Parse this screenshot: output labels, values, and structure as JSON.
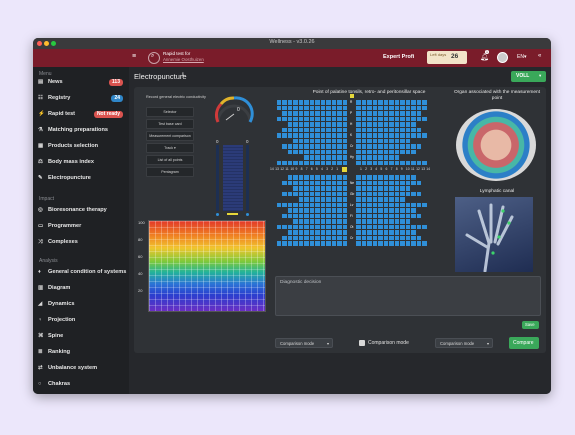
{
  "window": {
    "title": "Wellness - v3.0.26"
  },
  "topbar": {
    "search_title": "Rapid test for",
    "search_sub": "Annemie Oosthuizen",
    "profile": "Expert Profi",
    "days_label": "Left days",
    "days_value": "26",
    "notif_count": "1",
    "lang": "EN▾"
  },
  "sidebar": {
    "section_menu": "Menu",
    "section_impact": "Impact",
    "section_analysis": "Analysis",
    "items": [
      {
        "label": "News",
        "icon": "news-icon",
        "badge": "113"
      },
      {
        "label": "Registry",
        "icon": "registry-icon",
        "badge": "24"
      },
      {
        "label": "Rapid test",
        "icon": "rapid-test-icon",
        "badge": "Not ready"
      },
      {
        "label": "Matching preparations",
        "icon": "matching-icon"
      },
      {
        "label": "Products selection",
        "icon": "products-icon"
      },
      {
        "label": "Body mass index",
        "icon": "bmi-icon"
      },
      {
        "label": "Electropuncture",
        "icon": "pen-icon"
      },
      {
        "label": "Bioresonance therapy",
        "icon": "bioresonance-icon"
      },
      {
        "label": "Programmer",
        "icon": "programmer-icon"
      },
      {
        "label": "Complexes",
        "icon": "complexes-icon"
      },
      {
        "label": "General condition of systems",
        "icon": "condition-icon"
      },
      {
        "label": "Diagram",
        "icon": "diagram-icon"
      },
      {
        "label": "Dynamics",
        "icon": "dynamics-icon"
      },
      {
        "label": "Projection",
        "icon": "projection-icon"
      },
      {
        "label": "Spine",
        "icon": "spine-icon"
      },
      {
        "label": "Ranking",
        "icon": "ranking-icon"
      },
      {
        "label": "Unbalance system",
        "icon": "unbalance-icon"
      },
      {
        "label": "Chakras",
        "icon": "chakras-icon"
      }
    ]
  },
  "page": {
    "title": "Electropuncture",
    "mode_button": "VOLL"
  },
  "left_controls": {
    "record_label": "Record general electric conductivity",
    "buttons": [
      "Selector",
      "Test base card",
      "Measurement comparison",
      "Track ▾",
      "List of all points",
      "Pentagram"
    ]
  },
  "gauge": {
    "value": "0",
    "bar_left": "0",
    "bar_right": "0"
  },
  "spectrum": {
    "scale": [
      "100",
      "80",
      "60",
      "40",
      "20"
    ]
  },
  "diagram": {
    "title": "Point of palatine tonsils, retro- and peritonsillar space",
    "numbers_left": [
      "14",
      "13",
      "12",
      "11",
      "10",
      "9",
      "8",
      "7",
      "6",
      "5",
      "4",
      "3",
      "2",
      "1"
    ],
    "numbers_right": [
      "1",
      "2",
      "3",
      "4",
      "5",
      "6",
      "7",
      "8",
      "9",
      "10",
      "11",
      "12",
      "13",
      "14"
    ],
    "center_labels": [
      "R",
      "P",
      "H",
      "K",
      "Cr",
      "Hy",
      "Ne",
      "Gb",
      "Lv",
      "Fi",
      "Ot",
      "Cr",
      "Sv",
      "V"
    ]
  },
  "organ": {
    "title": "Organ associated with the measurement point",
    "canal_title": "Lymphatic canal"
  },
  "diagnostic": {
    "placeholder": "Diagnostic decision",
    "save": "Save"
  },
  "bottom": {
    "dd1": "Comparison mode",
    "checkbox_label": "Comparison mode",
    "dd2": "Comparison mode",
    "compare": "Compare"
  },
  "colors": {
    "accent_green": "#3aa85a",
    "topbar": "#7a1c2a",
    "cell_blue": "#2f8fd8",
    "badge_red": "#d9534f",
    "badge_blue": "#2f86c8"
  }
}
